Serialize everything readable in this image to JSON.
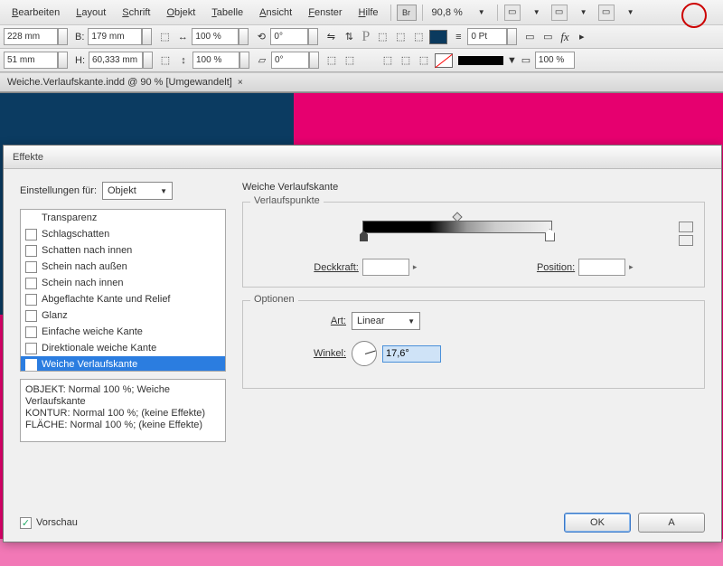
{
  "menu": {
    "items": [
      "Bearbeiten",
      "Layout",
      "Schrift",
      "Objekt",
      "Tabelle",
      "Ansicht",
      "Fenster",
      "Hilfe"
    ],
    "br": "Br",
    "zoom": "90,8 %"
  },
  "controls": {
    "x": "228 mm",
    "y": "51 mm",
    "b_lbl": "B:",
    "b": "179 mm",
    "h_lbl": "H:",
    "h": "60,333 mm",
    "scale1": "100 %",
    "scale2": "100 %",
    "angle": "0°",
    "shear": "0°",
    "stroke": "0 Pt",
    "p": "P",
    "pct": "100 %",
    "fx": "fx"
  },
  "tab": {
    "label": "Weiche.Verlaufskante.indd @ 90 % [Umgewandelt]",
    "close": "×"
  },
  "dialog": {
    "title": "Effekte",
    "settings_label": "Einstellungen für:",
    "settings_value": "Objekt",
    "effects": [
      "Transparenz",
      "Schlagschatten",
      "Schatten nach innen",
      "Schein nach außen",
      "Schein nach innen",
      "Abgeflachte Kante und Relief",
      "Glanz",
      "Einfache weiche Kante",
      "Direktionale weiche Kante",
      "Weiche Verlaufskante"
    ],
    "summary": "OBJEKT: Normal 100 %; Weiche Verlaufskante\nKONTUR: Normal 100 %; (keine Effekte)\nFLÄCHE: Normal 100 %; (keine Effekte)",
    "heading": "Weiche Verlaufskante",
    "group1": "Verlaufspunkte",
    "opacity_lbl": "Deckkraft:",
    "position_lbl": "Position:",
    "group2": "Optionen",
    "type_lbl": "Art:",
    "type_val": "Linear",
    "angle_lbl": "Winkel:",
    "angle_val": "17,6°",
    "preview": "Vorschau",
    "ok": "OK",
    "cancel": "A"
  }
}
